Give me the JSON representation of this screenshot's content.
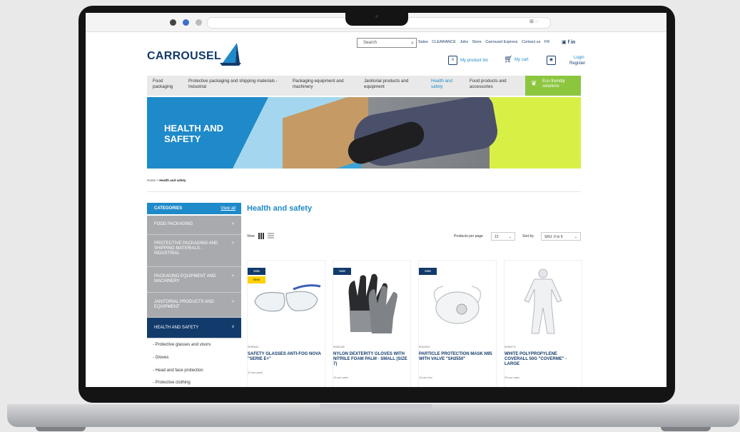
{
  "browser": {
    "url_right": "⊞ ◌"
  },
  "header": {
    "logo_text": "CARROUSEL",
    "search_placeholder": "Search",
    "top_links": [
      "Sales",
      "CLEARANCE",
      "Jobs",
      "Store",
      "Carrousel Express",
      "Contact us",
      "FR"
    ],
    "social_icons": [
      "youtube-icon",
      "facebook-icon",
      "linkedin-icon"
    ],
    "product_list": "My product list",
    "cart": "My cart",
    "login": "Login",
    "register": "Register"
  },
  "nav": {
    "items": [
      "Food packaging",
      "Protective packaging and shipping materials - Industrial",
      "Packaging equipment and machinery",
      "Janitorial products and equipment",
      "Health and safety",
      "Food products and accessories"
    ],
    "active_index": 4,
    "eco": "Eco-friendly solutions"
  },
  "hero": {
    "title_line1": "HEALTH AND",
    "title_line2": "SAFETY"
  },
  "breadcrumb": {
    "home": "Home",
    "sep": ">",
    "current": "Health and safety"
  },
  "sidebar": {
    "heading": "CATEGORIES",
    "view_all": "View all",
    "categories": [
      "FOOD PACKAGING",
      "PROTECTIVE PACKAGING AND SHIPPING MATERIALS - INDUSTRIAL",
      "PACKAGING EQUIPMENT AND MACHINERY",
      "JANITORIAL PRODUCTS AND EQUIPMENT",
      "HEALTH AND SAFETY"
    ],
    "subcategories": [
      "- Protective glasses and visors",
      "- Gloves",
      "- Head and face protection",
      "- Protective clothing"
    ]
  },
  "main": {
    "title": "Health and safety",
    "view_label": "View",
    "per_page_label": "Products per page",
    "per_page_value": "12",
    "sort_label": "Sort by",
    "sort_value": "SKU: 0 to 9"
  },
  "products": [
    {
      "badges": [
        "Sale",
        "New"
      ],
      "sku": "9050644",
      "name": "SAFETY GLASSES ANTI-FOG NOVA \"SERIE E+\"",
      "unit": "12 per pack"
    },
    {
      "badges": [
        "Sale"
      ],
      "sku": "9050148",
      "name": "NYLON DEXTERITY GLOVES WITH NITRILE FOAM PALM - SMALL (SIZE 7)",
      "unit": "12 per pack"
    },
    {
      "badges": [
        "Sale"
      ],
      "sku": "9052001",
      "name": "PARTICLE PROTECTION MASK N95 WITH VALVE \"SH2550\"",
      "unit": "10 per box"
    },
    {
      "badges": [],
      "sku": "9050273",
      "name": "WHITE POLYPROPYLENE COVERALL 50G \"COVERME\" - LARGE",
      "unit": "25 per case"
    }
  ],
  "colors": {
    "brand_blue": "#1f8ac9",
    "navy": "#123a6b",
    "eco_green": "#8cc63f",
    "new_yellow": "#ffd200"
  }
}
